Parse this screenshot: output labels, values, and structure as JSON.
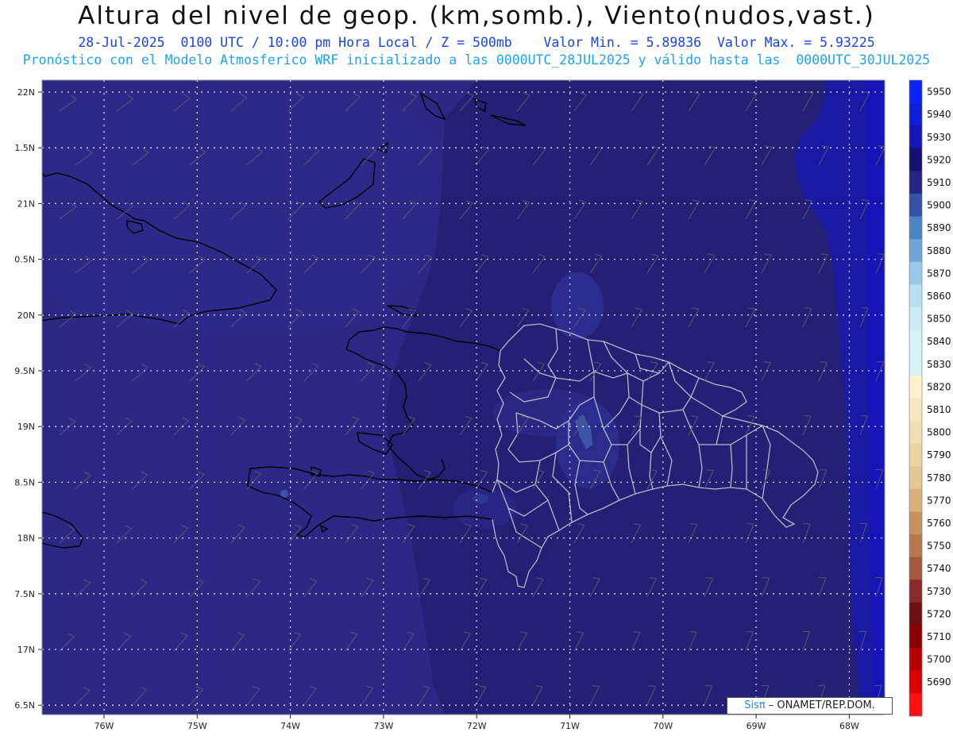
{
  "header": {
    "title": "Altura del nivel de geop. (km,somb.), Viento(nudos,vast.)",
    "line1": "28-Jul-2025  0100 UTC / 10:00 pm Hora Local / Z = 500mb    Valor Min. = 5.89836  Valor Max. = 5.93225",
    "line2": "Pronóstico con el Modelo Atmosferico WRF inicializado a las 0000UTC_28JUL2025 y válido hasta las  0000UTC_30JUL2025"
  },
  "map": {
    "lat_labels": [
      "22N",
      "1.5N",
      "21N",
      "0.5N",
      "20N",
      "9.5N",
      "19N",
      "8.5N",
      "18N",
      "7.5N",
      "17N",
      "6.5N"
    ],
    "lon_labels": [
      "76W",
      "75W",
      "74W",
      "73W",
      "72W",
      "71W",
      "70W",
      "69W",
      "68W"
    ],
    "colors": {
      "ocean_main": "#232076",
      "ocean_dark": "#1a1766",
      "west_light": "#2b2886",
      "east_band": "#1a19a4",
      "land_highlight": "#3c54a8",
      "coast": "#000000",
      "province_border": "#b8b8c8"
    }
  },
  "colorbar": {
    "levels": [
      "5950",
      "5940",
      "5930",
      "5920",
      "5910",
      "5900",
      "5890",
      "5880",
      "5870",
      "5860",
      "5850",
      "5840",
      "5830",
      "5820",
      "5810",
      "5800",
      "5790",
      "5780",
      "5770",
      "5760",
      "5750",
      "5740",
      "5730",
      "5720",
      "5710",
      "5700",
      "5690"
    ],
    "colors": [
      "#0b22ff",
      "#0f1fd8",
      "#1514b4",
      "#16106e",
      "#262484",
      "#3552a6",
      "#4a84c4",
      "#6ea6d6",
      "#9ac8e8",
      "#b8e2f0",
      "#cdecf5",
      "#d8f1f7",
      "#d7f3f6",
      "#fdf3cd",
      "#f5e8c0",
      "#f1e0b3",
      "#ead6a5",
      "#e4c894",
      "#d8b07a",
      "#c89260",
      "#b8784e",
      "#a45a3e",
      "#8a2a2a",
      "#6a1010",
      "#8e0000",
      "#b40000",
      "#dc0000",
      "#ff1010"
    ]
  },
  "credit": {
    "brand": "Sisπ",
    "text": " – ONAMET/REP.DOM."
  }
}
